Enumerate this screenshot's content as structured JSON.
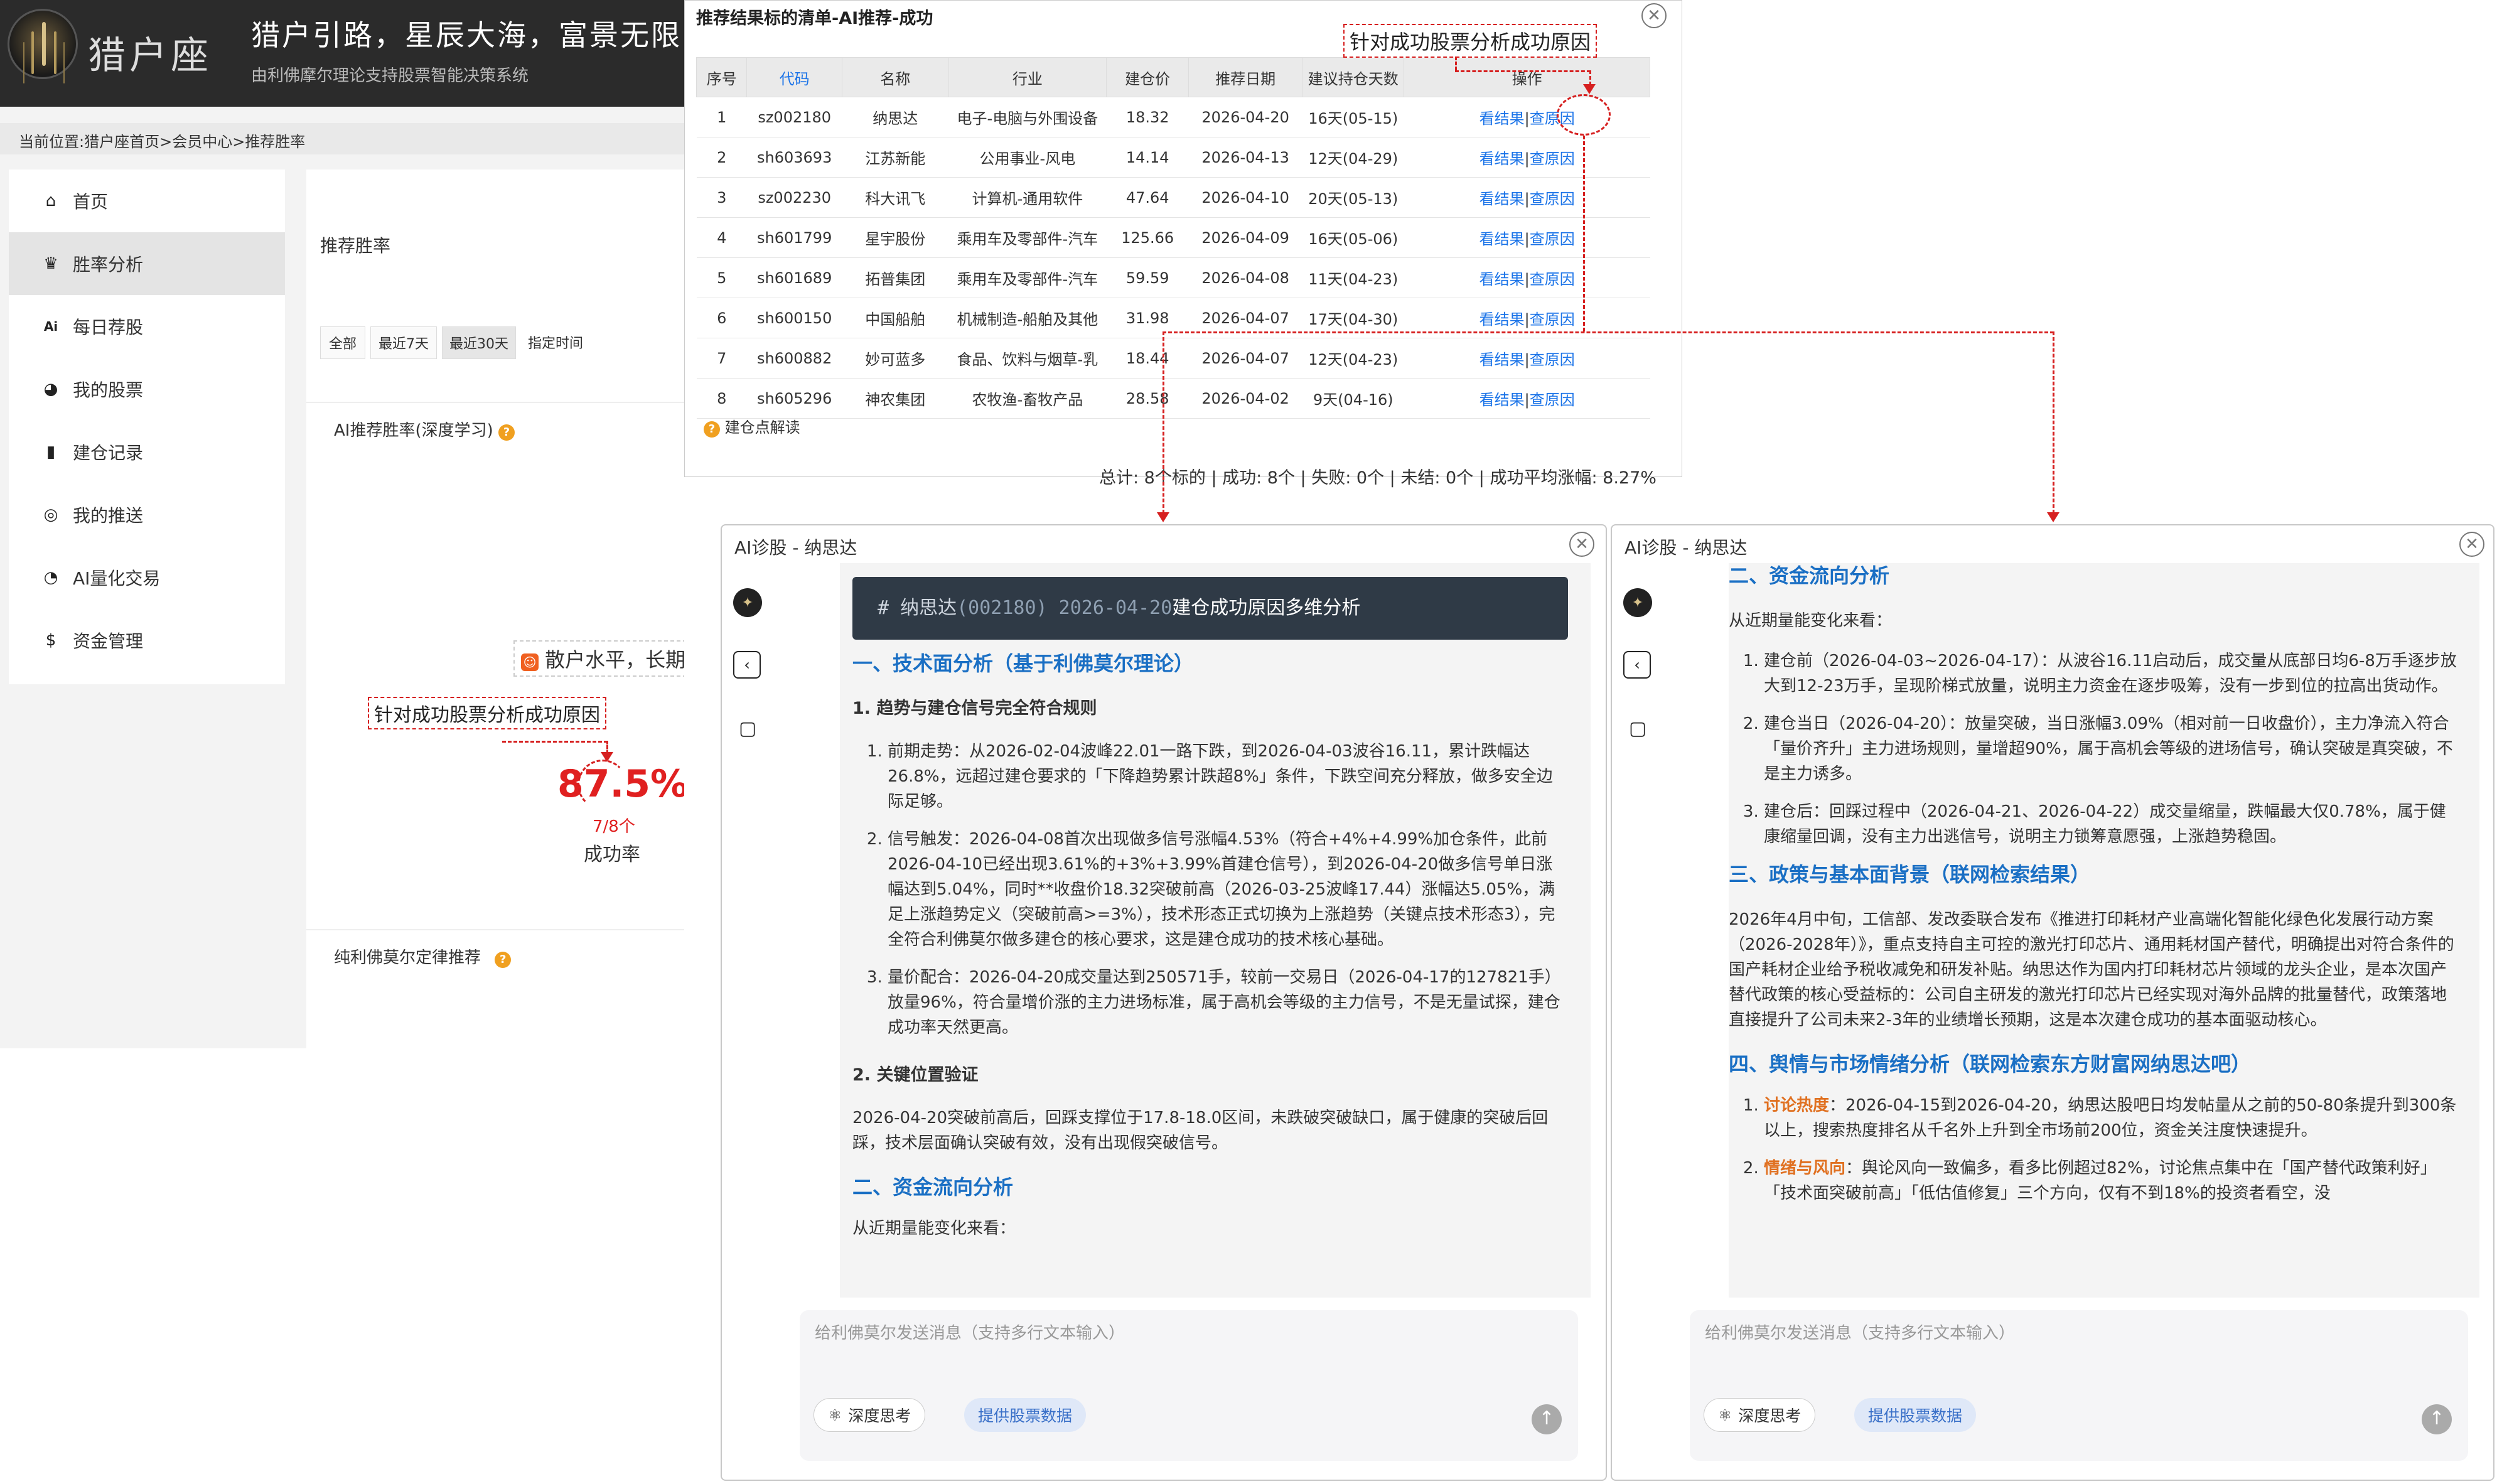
{
  "site": {
    "logo_text": "猎户座",
    "slogan": "猎户引路，星辰大海，富景无限",
    "subslogan": "由利佛摩尔理论支持股票智能决策系统",
    "breadcrumb": "当前位置:猎户座首页>会员中心>推荐胜率",
    "nav": [
      {
        "label": "首页",
        "icon": "home-icon"
      },
      {
        "label": "胜率分析",
        "icon": "crown-icon"
      },
      {
        "label": "每日荐股",
        "icon": "ai-icon"
      },
      {
        "label": "我的股票",
        "icon": "stock-icon"
      },
      {
        "label": "建仓记录",
        "icon": "chart-icon"
      },
      {
        "label": "我的推送",
        "icon": "push-icon"
      },
      {
        "label": "AI量化交易",
        "icon": "ai-quant-icon"
      },
      {
        "label": "资金管理",
        "icon": "money-icon"
      }
    ],
    "panel_title": "推荐胜率",
    "filters": [
      "全部",
      "最近7天",
      "最近30天",
      "指定时间"
    ],
    "ai_rate_label": "AI推荐胜率(深度学习)",
    "retail_label": "散户水平，长期",
    "rate_value": "87.5%",
    "rate_ratio": "7/8个",
    "rate_caption": "成功率",
    "liver_label": "纯利佛莫尔定律推荐"
  },
  "annotations": {
    "left_box": "针对成功股票分析成功原因",
    "top_box": "针对成功股票分析成功原因"
  },
  "list_modal": {
    "title": "推荐结果标的清单-AI推荐-成功",
    "close": "✕",
    "headers": [
      "序号",
      "代码",
      "名称",
      "行业",
      "建仓价",
      "推荐日期",
      "建议持仓天数",
      "操作"
    ],
    "rows": [
      {
        "no": "1",
        "code": "sz002180",
        "name": "纳思达",
        "industry": "电子-电脑与外围设备",
        "price": "18.32",
        "date": "2026-04-20",
        "days": "16天(05-15)"
      },
      {
        "no": "2",
        "code": "sh603693",
        "name": "江苏新能",
        "industry": "公用事业-风电",
        "price": "14.14",
        "date": "2026-04-13",
        "days": "12天(04-29)"
      },
      {
        "no": "3",
        "code": "sz002230",
        "name": "科大讯飞",
        "industry": "计算机-通用软件",
        "price": "47.64",
        "date": "2026-04-10",
        "days": "20天(05-13)"
      },
      {
        "no": "4",
        "code": "sh601799",
        "name": "星宇股份",
        "industry": "乘用车及零部件-汽车",
        "price": "125.66",
        "date": "2026-04-09",
        "days": "16天(05-06)"
      },
      {
        "no": "5",
        "code": "sh601689",
        "name": "拓普集团",
        "industry": "乘用车及零部件-汽车",
        "price": "59.59",
        "date": "2026-04-08",
        "days": "11天(04-23)"
      },
      {
        "no": "6",
        "code": "sh600150",
        "name": "中国船舶",
        "industry": "机械制造-船舶及其他",
        "price": "31.98",
        "date": "2026-04-07",
        "days": "17天(04-30)"
      },
      {
        "no": "7",
        "code": "sh600882",
        "name": "妙可蓝多",
        "industry": "食品、饮料与烟草-乳",
        "price": "18.44",
        "date": "2026-04-07",
        "days": "12天(04-23)"
      },
      {
        "no": "8",
        "code": "sh605296",
        "name": "神农集团",
        "industry": "农牧渔-畜牧产品",
        "price": "28.58",
        "date": "2026-04-02",
        "days": "9天(04-16)"
      }
    ],
    "action_result": "看结果",
    "action_sep": "|",
    "action_reason": "查原因",
    "legend": "建仓点解读",
    "summary": "总计: 8个标的 | 成功: 8个 | 失败: 0个 | 未结: 0个 | 成功平均涨幅: 8.27%"
  },
  "chat_left": {
    "title": "AI诊股 - 纳思达",
    "code_header_a": "# 纳思达",
    "code_header_b": "(002180) 2026-04-20",
    "code_header_c": "建仓成功原因多维分析",
    "h1": "一、技术面分析（基于利佛莫尔理论）",
    "h1_1": "1. 趋势与建仓信号完全符合规则",
    "items": [
      "前期走势：从2026-02-04波峰22.01一路下跌，到2026-04-03波谷16.11，累计跌幅达26.8%，远超过建仓要求的「下降趋势累计跌超8%」条件，下跌空间充分释放，做多安全边际足够。",
      "信号触发：2026-04-08首次出现做多信号涨幅4.53%（符合+4%+4.99%加仓条件，此前2026-04-10已经出现3.61%的+3%+3.99%首建仓信号），到2026-04-20做多信号单日涨幅达到5.04%，同时**收盘价18.32突破前高（2026-03-25波峰17.44）涨幅达5.05%，满足上涨趋势定义（突破前高>=3%），技术形态正式切换为上涨趋势（关键点技术形态3），完全符合利佛莫尔做多建仓的核心要求，这是建仓成功的技术核心基础。",
      "量价配合：2026-04-20成交量达到250571手，较前一交易日（2026-04-17的127821手）放量96%，符合量增价涨的主力进场标准，属于高机会等级的主力信号，不是无量试探，建仓成功率天然更高。"
    ],
    "h1_2": "2. 关键位置验证",
    "p_key": "2026-04-20突破前高后，回踩支撑位于17.8-18.0区间，未跌破突破缺口，属于健康的突破后回踩，技术层面确认突破有效，没有出现假突破信号。",
    "h2": "二、资金流向分析",
    "tail": "从近期量能变化来看：",
    "input_placeholder": "给利佛莫尔发送消息（支持多行文本输入）",
    "deep_think": "深度思考",
    "provide_data": "提供股票数据"
  },
  "chat_right": {
    "title": "AI诊股 - 纳思达",
    "h2": "二、资金流向分析",
    "p_intro": "从近期量能变化来看：",
    "items": [
      "建仓前（2026-04-03~2026-04-17）：从波谷16.11启动后，成交量从底部日均6-8万手逐步放大到12-23万手，呈现阶梯式放量，说明主力资金在逐步吸筹，没有一步到位的拉高出货动作。",
      "建仓当日（2026-04-20）：放量突破，当日涨幅3.09%（相对前一日收盘价），主力净流入符合「量价齐升」主力进场规则，量增超90%，属于高机会等级的进场信号，确认突破是真突破，不是主力诱多。",
      "建仓后：回踩过程中（2026-04-21、2026-04-22）成交量缩量，跌幅最大仅0.78%，属于健康缩量回调，没有主力出逃信号，说明主力锁筹意愿强，上涨趋势稳固。"
    ],
    "h3": "三、政策与基本面背景（联网检索结果）",
    "p_policy": "2026年4月中旬，工信部、发改委联合发布《推进打印耗材产业高端化智能化绿色化发展行动方案（2026-2028年）》，重点支持自主可控的激光打印芯片、通用耗材国产替代，明确提出对符合条件的国产耗材企业给予税收减免和研发补贴。纳思达作为国内打印耗材芯片领域的龙头企业，是本次国产替代政策的核心受益标的：公司自主研发的激光打印芯片已经实现对海外品牌的批量替代，政策落地直接提升了公司未来2-3年的业绩增长预期，这是本次建仓成功的基本面驱动核心。",
    "h4": "四、舆情与市场情绪分析（联网检索东方财富网纳思达吧）",
    "s1_label": "讨论热度",
    "s1_text": "：2026-04-15到2026-04-20，纳思达股吧日均发帖量从之前的50-80条提升到300条以上，搜索热度排名从千名外上升到全市场前200位，资金关注度快速提升。",
    "s2_label": "情绪与风向",
    "s2_text": "：舆论风向一致偏多，看多比例超过82%，讨论焦点集中在「国产替代政策利好」「技术面突破前高」「低估值修复」三个方向，仅有不到18%的投资者看空，没",
    "input_placeholder": "给利佛莫尔发送消息（支持多行文本输入）",
    "deep_think": "深度思考",
    "provide_data": "提供股票数据"
  },
  "colors": {
    "accent_blue": "#1a73e8",
    "heading_blue": "#1a6fc4",
    "annotation_red": "#d62020",
    "rate_red": "#e02020",
    "code_header_bg": "#2f3a46"
  }
}
